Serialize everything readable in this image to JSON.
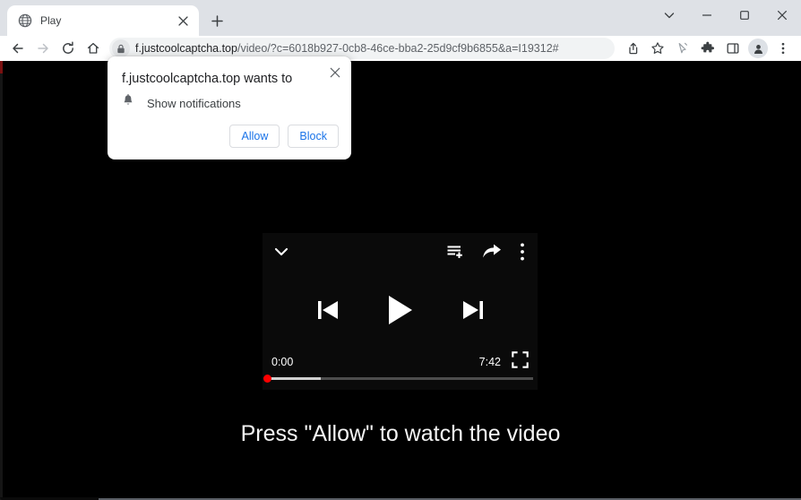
{
  "window": {
    "controls": {
      "tab_search": "tab-search",
      "minimize": "minimize",
      "maximize": "maximize",
      "close": "close"
    }
  },
  "tabstrip": {
    "tabs": [
      {
        "title": "Play",
        "favicon": "globe-icon",
        "close": "close-tab-icon"
      }
    ],
    "new_tab_label": "+"
  },
  "toolbar": {
    "back": "back-icon",
    "forward": "forward-icon",
    "reload": "reload-icon",
    "home": "home-icon",
    "lock": "lock-icon",
    "url_host": "f.justcoolcaptcha.top",
    "url_path": "/video/?c=6018b927-0cb8-46ce-bba2-25d9cf9b6855&a=I19312#",
    "url_full": "f.justcoolcaptcha.top/video/?c=6018b927-0cb8-46ce-bba2-25d9cf9b6855&a=I19312#",
    "right_icons": [
      "share-icon",
      "bookmark-star-icon",
      "pen-cursor-icon",
      "extensions-puzzle-icon",
      "side-panel-icon",
      "profile-avatar-icon",
      "chrome-menu-icon"
    ]
  },
  "permission_bubble": {
    "title": "f.justcoolcaptcha.top wants to",
    "permission_icon": "bell-icon",
    "permission_label": "Show notifications",
    "allow_label": "Allow",
    "block_label": "Block",
    "close_icon": "close-icon"
  },
  "page": {
    "background_color": "#000000",
    "headline": "Press \"Allow\" to watch the video",
    "player": {
      "collapse_icon": "chevron-down-icon",
      "add_to_queue_icon": "add-to-queue-icon",
      "share_icon": "share-arrow-icon",
      "more_icon": "more-vertical-icon",
      "previous_icon": "previous-track-icon",
      "play_icon": "play-icon",
      "next_icon": "next-track-icon",
      "current_time": "0:00",
      "duration": "7:42",
      "fullscreen_icon": "fullscreen-icon",
      "progress_percent": 0,
      "buffered_percent": 20,
      "accent_color": "#ff0000"
    }
  }
}
